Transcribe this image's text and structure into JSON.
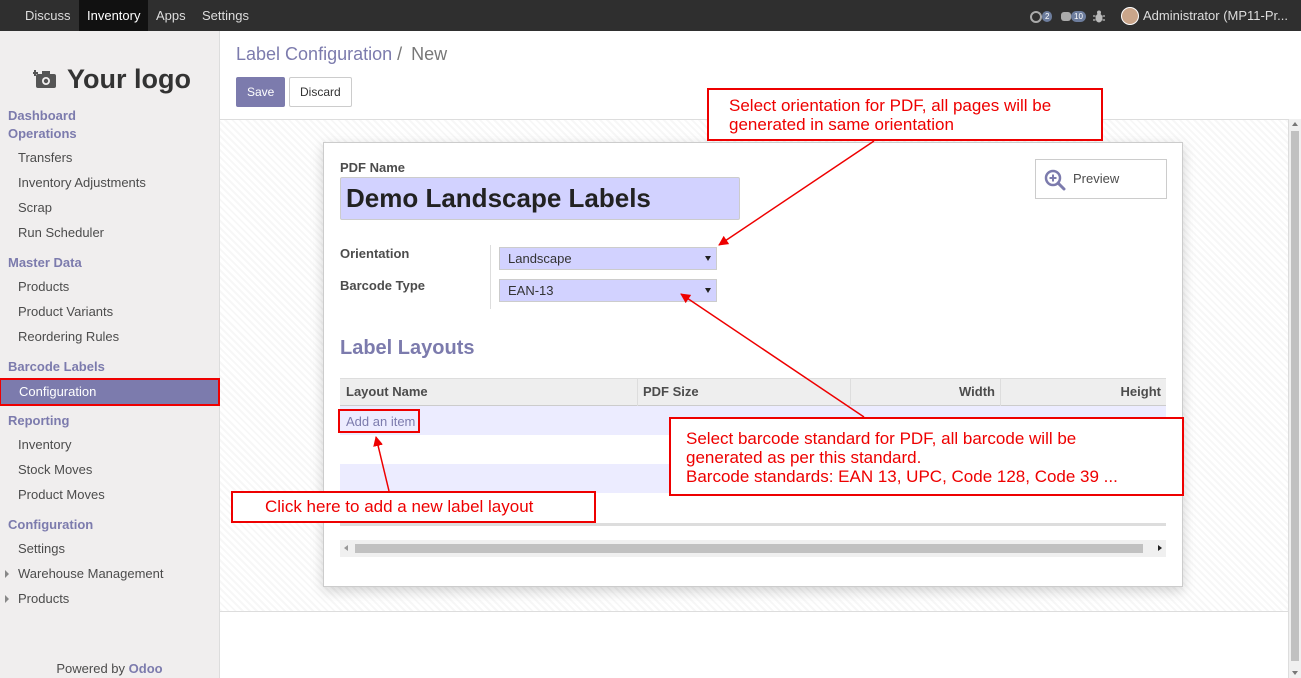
{
  "topbar": {
    "menu": [
      "Discuss",
      "Inventory",
      "Apps",
      "Settings"
    ],
    "active": "Inventory",
    "activity_badge": "2",
    "messages_badge": "10",
    "user": "Administrator (MP11-Pr..."
  },
  "sidebar": {
    "logo_text": "Your logo",
    "sections": [
      {
        "head": "Dashboard"
      },
      {
        "head": "Operations",
        "items": [
          "Transfers",
          "Inventory Adjustments",
          "Scrap",
          "Run Scheduler"
        ]
      },
      {
        "head": "Master Data",
        "items": [
          "Products",
          "Product Variants",
          "Reordering Rules"
        ]
      },
      {
        "head": "Barcode Labels",
        "items": [
          "Configuration"
        ]
      },
      {
        "head": "Reporting",
        "items": [
          "Inventory",
          "Stock Moves",
          "Product Moves"
        ]
      },
      {
        "head": "Configuration",
        "items": [
          "Settings",
          "Warehouse Management",
          "Products"
        ]
      }
    ],
    "powered_prefix": "Powered by",
    "powered_brand": "Odoo"
  },
  "breadcrumb": {
    "parent": "Label Configuration",
    "separator": "/",
    "current": "New"
  },
  "buttons": {
    "save": "Save",
    "discard": "Discard",
    "preview": "Preview"
  },
  "form": {
    "pdf_name_label": "PDF Name",
    "pdf_name_value": "Demo Landscape Labels",
    "orientation_label": "Orientation",
    "orientation_value": "Landscape",
    "barcode_type_label": "Barcode Type",
    "barcode_type_value": "EAN-13",
    "layouts_title": "Label Layouts",
    "columns": [
      "Layout Name",
      "PDF Size",
      "Width",
      "Height"
    ],
    "add_item": "Add an item"
  },
  "annotations": {
    "orientation": [
      "Select orientation for PDF, all pages will be",
      "generated in same orientation"
    ],
    "barcode": [
      "Select barcode standard for PDF, all barcode will be",
      "generated as per this standard.",
      "Barcode standards: EAN 13, UPC, Code 128, Code 39 ..."
    ],
    "add": "Click here to add a new label layout"
  },
  "colors": {
    "brand": "#7c7bad",
    "annotation": "#ee0000",
    "field_bg": "#d2d2ff",
    "topbar": "#2f2f2f"
  }
}
